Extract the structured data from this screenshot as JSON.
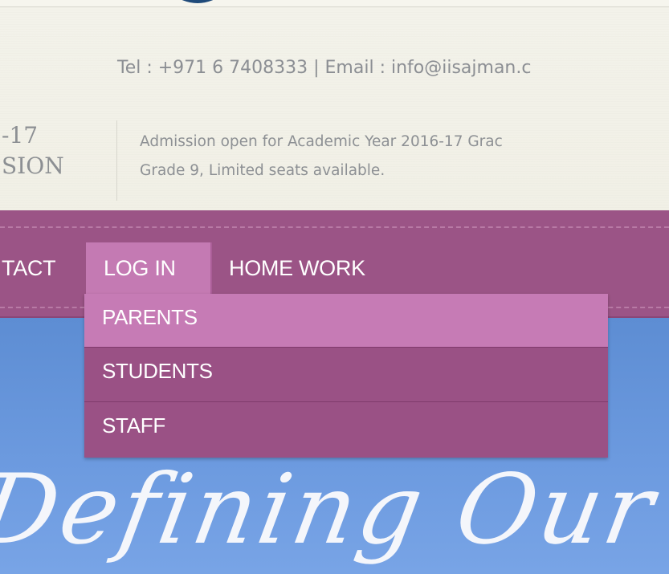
{
  "header": {
    "contact_line": "Tel : +971 6 7408333 | Email : info@iisajman.c",
    "session_year": "-17",
    "session_label": "SION",
    "admission_line_1": "Admission open for Academic Year 2016-17 Grac",
    "admission_line_2": "Grade 9, Limited seats available."
  },
  "nav": {
    "items": [
      {
        "label": "TACT"
      },
      {
        "label": "LOG IN",
        "active": true
      },
      {
        "label": "HOME WORK"
      }
    ]
  },
  "dropdown": {
    "items": [
      {
        "label": "PARENTS",
        "highlighted": true
      },
      {
        "label": "STUDENTS"
      },
      {
        "label": "STAFF"
      }
    ]
  },
  "hero": {
    "tagline": "Defining Our F"
  },
  "colors": {
    "nav_bg": "#9b5486",
    "nav_active": "#c47ab3",
    "hero_blue": "#6d9be0",
    "cream": "#f2f1e8",
    "logo_blue": "#1f4a7a"
  },
  "icons": {
    "logo": "school-logo-emblem"
  }
}
